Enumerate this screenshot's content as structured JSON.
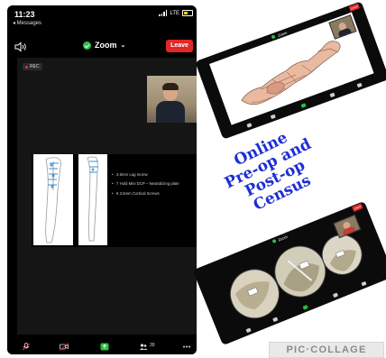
{
  "phone": {
    "status": {
      "time": "11:23",
      "back": "◂ Messages",
      "network": "LTE"
    },
    "meeting": {
      "title": "Zoom",
      "leave_label": "Leave",
      "rec_label": "REC"
    },
    "slide_bullets": [
      "3.5mm Lag Screw",
      "7 Hold Mini DCP – Neutralizing plate",
      "6 3.5mm Cortical Screws"
    ],
    "toolbar": {
      "participants_count": "39"
    }
  },
  "tablet_top": {
    "title": "Zoom",
    "leave_label": "Leave"
  },
  "overlay_text": {
    "lines": [
      "Online",
      "Pre-op and",
      "Post-op",
      "Census"
    ],
    "color": "#1d2fd3"
  },
  "tablet_bottom": {
    "title": "Zoom",
    "leave_label": "Leave"
  },
  "collage_badge": "PIC·COLLAGE",
  "colors": {
    "leave_red": "#e02828",
    "secure_green": "#2fbf4a",
    "unmute_green": "#27c23c"
  }
}
